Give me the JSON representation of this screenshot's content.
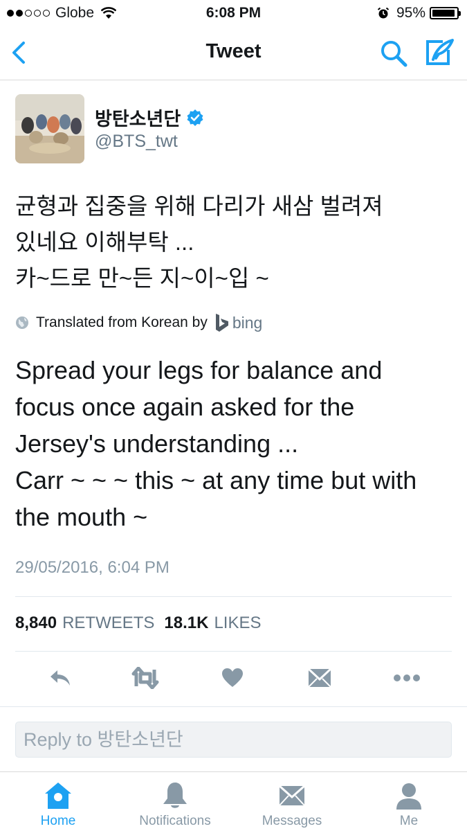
{
  "status_bar": {
    "carrier": "Globe",
    "time": "6:08 PM",
    "battery": "95%",
    "battery_level": 0.95
  },
  "nav": {
    "title": "Tweet",
    "icons": [
      "back-icon",
      "search-icon",
      "compose-icon"
    ]
  },
  "author": {
    "display_name": "방탄소년단",
    "handle": "@BTS_twt",
    "verified": true
  },
  "tweet": {
    "text_lines": [
      "균형과 집중을 위해 다리가 새삼 벌려져",
      "있네요 이해부탁 ...",
      "카~드로 만~든 지~이~입 ~"
    ],
    "translated_label": "Translated from Korean by",
    "translator": "bing",
    "translation_lines": [
      "Spread your legs for balance and",
      "focus once again asked for the",
      "Jersey's understanding ...",
      "Carr ~ ~ ~ this ~ at any time but with",
      "the mouth ~"
    ],
    "timestamp": "29/05/2016, 6:04 PM"
  },
  "stats": {
    "retweets_count": "8,840",
    "retweets_label": "RETWEETS",
    "likes_count": "18.1K",
    "likes_label": "LIKES"
  },
  "actions": [
    "reply-icon",
    "retweet-icon",
    "like-icon",
    "message-icon",
    "more-icon"
  ],
  "reply": {
    "placeholder": "Reply to 방탄소년단"
  },
  "tabs": [
    {
      "label": "Home",
      "icon": "home-icon",
      "active": true
    },
    {
      "label": "Notifications",
      "icon": "bell-icon",
      "active": false
    },
    {
      "label": "Messages",
      "icon": "envelope-icon",
      "active": false
    },
    {
      "label": "Me",
      "icon": "person-icon",
      "active": false
    }
  ],
  "colors": {
    "accent": "#1da1f2",
    "text": "#14171a",
    "secondary_text": "#657786",
    "icon_gray": "#8899a6"
  }
}
